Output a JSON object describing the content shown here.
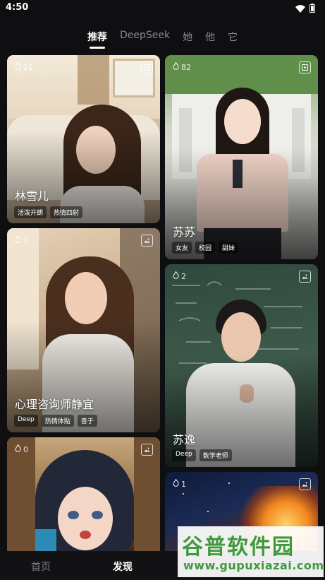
{
  "status_bar": {
    "time": "4:50"
  },
  "tabs": [
    {
      "label": "推荐"
    },
    {
      "label": "DeepSeek"
    },
    {
      "label": "她"
    },
    {
      "label": "他"
    },
    {
      "label": "它"
    }
  ],
  "cards": [
    {
      "title": "林雪儿",
      "count": "21",
      "type_icon": "video-icon",
      "tags": [
        "活泼开朗",
        "热情四射"
      ]
    },
    {
      "title": "苏苏",
      "count": "82",
      "type_icon": "video-icon",
      "tags": [
        "女友",
        "校园",
        "甜妹"
      ]
    },
    {
      "title": "心理咨询师静宜",
      "count": "0",
      "type_icon": "image-icon",
      "tags": [
        "Deep",
        "热情体贴",
        "善于"
      ]
    },
    {
      "title": "苏逸",
      "count": "2",
      "type_icon": "image-icon",
      "tags": [
        "Deep",
        "数学老师"
      ]
    },
    {
      "title": "",
      "count": "0",
      "type_icon": "image-icon",
      "tags": []
    },
    {
      "title": "",
      "count": "1",
      "type_icon": "image-icon",
      "tags": []
    }
  ],
  "bottom_nav": {
    "home": "首页",
    "discover": "发现"
  },
  "watermark": {
    "title": "谷普软件园",
    "url": "www.gupuxiazai.com"
  },
  "colors": {
    "background": "#0f0f11",
    "watermark_green": "#3d9a3d"
  }
}
